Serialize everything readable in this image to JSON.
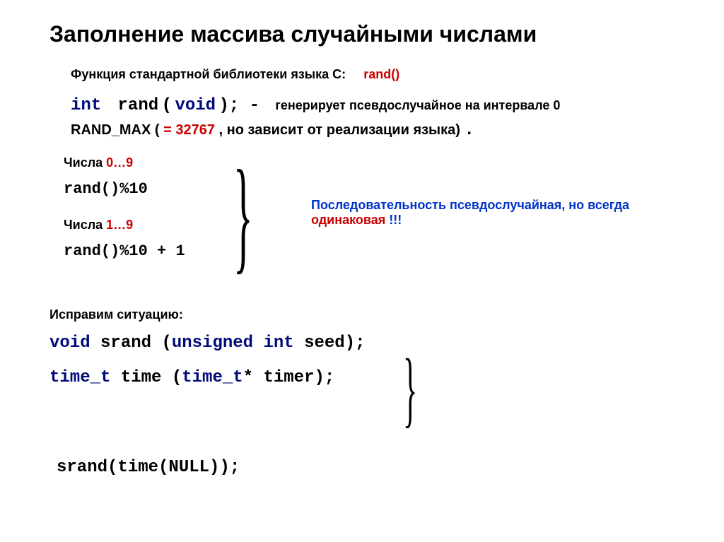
{
  "title": "Заполнение массива случайными числами",
  "intro_label": "Функция стандартной библиотеки языка С:",
  "intro_fn": "rand()",
  "proto_kw_int": "int",
  "proto_fn": "rand",
  "proto_kw_void": "void",
  "proto_punct_a": "(",
  "proto_punct_b": "); -",
  "proto_desc": "генерирует псевдослучайное на интервале 0",
  "rm_prefix": "RAND_MAX (",
  "rm_value": "= 32767",
  "rm_suffix": ", но зависит от реализации языка)",
  "dot": ".",
  "ex1_label_a": "Числа ",
  "ex1_label_b": "0…9",
  "ex1_code": "rand()%10",
  "ex2_label_a": "Числа ",
  "ex2_label_b": "1…9",
  "ex2_code": "rand()%10 + 1",
  "brace": "}",
  "seq_a": "Последовательность псевдослучайная, но всегда ",
  "seq_b": "одинаковая",
  "seq_c": " !!!",
  "fix_label": "Исправим ситуацию:",
  "srand_kw_void": "void",
  "srand_fn": " srand ",
  "srand_open": "(",
  "srand_kw_unsigned": "unsigned",
  "srand_sp": " ",
  "srand_kw_int": "int",
  "srand_arg": " seed",
  "srand_close": ");",
  "time_kw_t1": "time_t",
  "time_fn": " time ",
  "time_open": "(",
  "time_kw_t2": "time_t",
  "time_arg": "* timer",
  "time_close": ");",
  "call": "srand(time(NULL));"
}
